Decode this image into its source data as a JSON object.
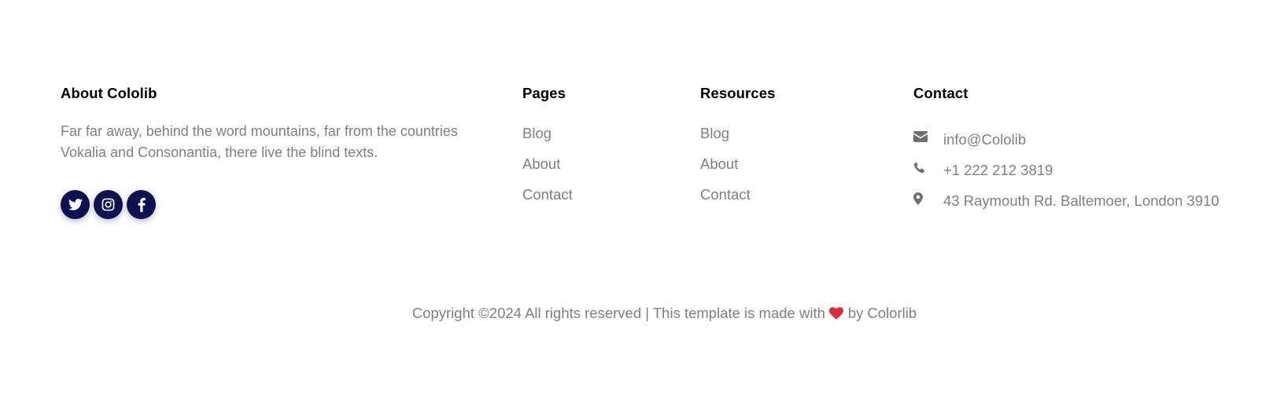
{
  "about": {
    "heading": "About Cololib",
    "text": "Far far away, behind the word mountains, far from the countries Vokalia and Consonantia, there live the blind texts.",
    "social": [
      {
        "icon": "twitter-icon"
      },
      {
        "icon": "instagram-icon"
      },
      {
        "icon": "facebook-icon"
      }
    ]
  },
  "pages": {
    "heading": "Pages",
    "links": [
      "Blog",
      "About",
      "Contact"
    ]
  },
  "resources": {
    "heading": "Resources",
    "links": [
      "Blog",
      "About",
      "Contact"
    ]
  },
  "contact": {
    "heading": "Contact",
    "items": [
      {
        "icon": "envelope-icon",
        "text": "info@Cololib"
      },
      {
        "icon": "phone-icon",
        "text": "+1 222 212 3819"
      },
      {
        "icon": "map-marker-icon",
        "text": "43 Raymouth Rd. Baltemoer, London 3910"
      }
    ]
  },
  "copyright": {
    "prefix": "Copyright ©2024 All rights reserved | This template is made with",
    "by": "by",
    "link": "Colorlib",
    "heart_icon": "heart-icon"
  },
  "colors": {
    "social_bg": "#0b1153",
    "heart": "#e0283a",
    "text_muted": "#808080",
    "heading": "#000000",
    "icon_gray": "#6f6f6f"
  }
}
